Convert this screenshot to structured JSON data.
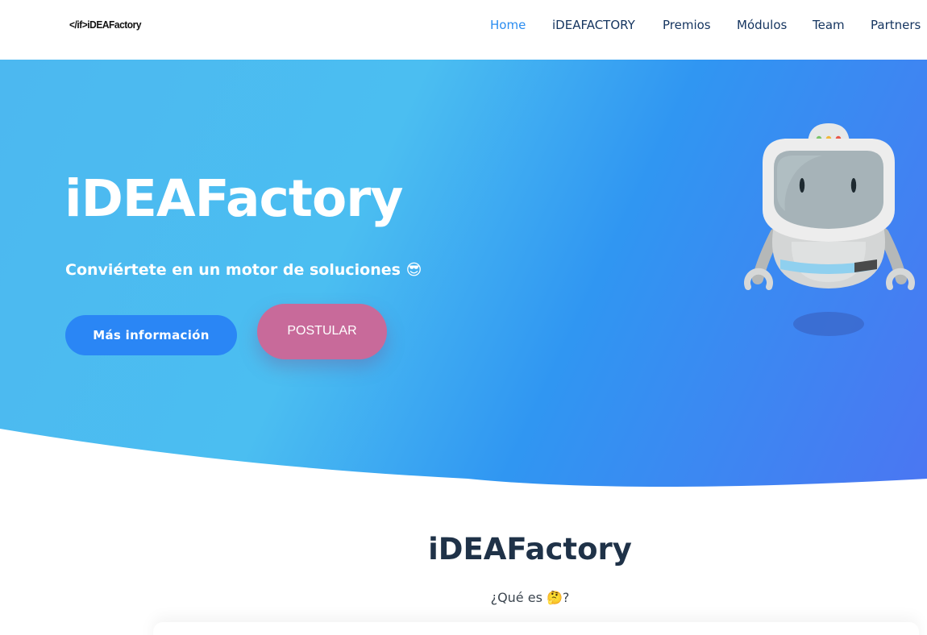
{
  "nav": {
    "logo": "</if>iDEAFactory",
    "items": [
      {
        "label": "Home",
        "active": true
      },
      {
        "label": "iDEAFACTORY",
        "active": false
      },
      {
        "label": "Premios",
        "active": false
      },
      {
        "label": "Módulos",
        "active": false
      },
      {
        "label": "Team",
        "active": false
      },
      {
        "label": "Partners",
        "active": false
      }
    ]
  },
  "hero": {
    "title": "iDEAFactory",
    "subtitle": "Conviértete en un motor de soluciones 😎",
    "buttons": {
      "info": "Más información",
      "postular": "POSTULAR"
    },
    "illustration": "robot-icon"
  },
  "section": {
    "title": "iDEAFactory",
    "subtitle": "¿Qué es 🤔?"
  },
  "colors": {
    "nav_text": "#14345f",
    "nav_active": "#2a8cf0",
    "hero_light": "#4cbcf0",
    "hero_mid": "#2f8ff2",
    "hero_dark": "#4a78f2",
    "info_button": "#2a86f5",
    "postular_button": "#c86a9a",
    "section_title": "#1f3248"
  }
}
